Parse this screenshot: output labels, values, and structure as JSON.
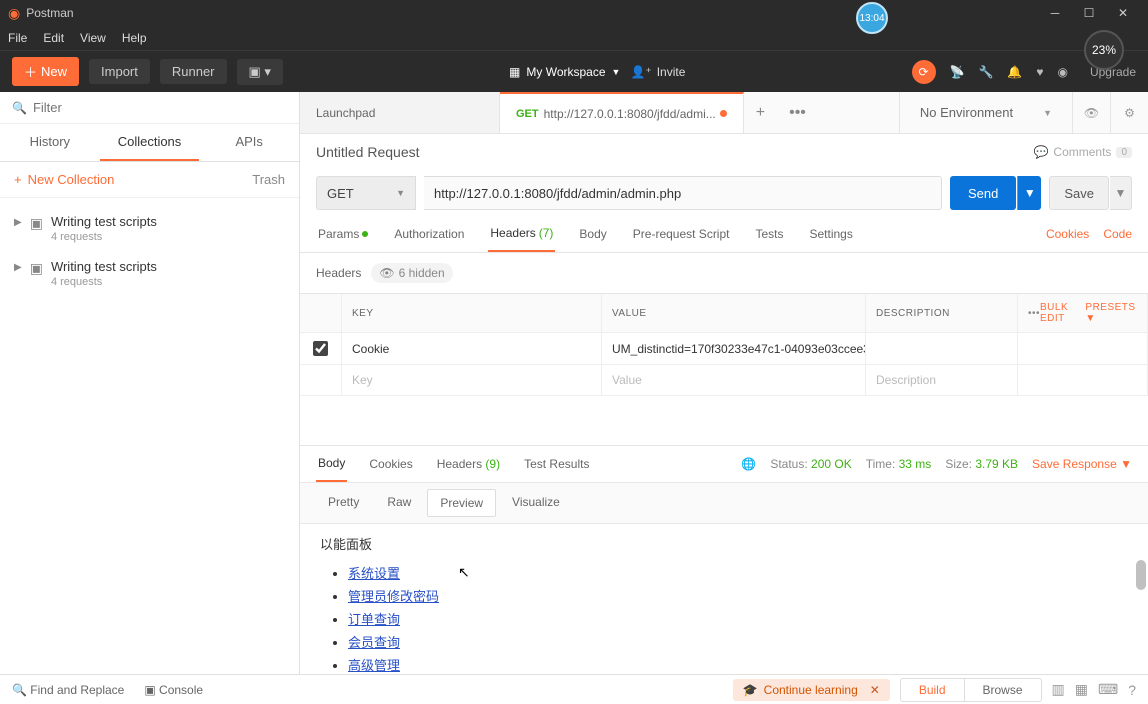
{
  "app": {
    "title": "Postman"
  },
  "overlay": {
    "clock": "13:04",
    "battery": "23%"
  },
  "menu": {
    "file": "File",
    "edit": "Edit",
    "view": "View",
    "help": "Help"
  },
  "toolbar": {
    "new": "New",
    "import": "Import",
    "runner": "Runner",
    "workspace": "My Workspace",
    "invite": "Invite",
    "upgrade": "Upgrade"
  },
  "sidebar": {
    "filter_placeholder": "Filter",
    "tabs": {
      "history": "History",
      "collections": "Collections",
      "apis": "APIs"
    },
    "new_collection": "New Collection",
    "trash": "Trash",
    "items": [
      {
        "title": "Writing test scripts",
        "sub": "4 requests"
      },
      {
        "title": "Writing test scripts",
        "sub": "4 requests"
      }
    ]
  },
  "tabs": {
    "launchpad": "Launchpad",
    "active_method": "GET",
    "active_url": "http://127.0.0.1:8080/jfdd/admi..."
  },
  "environment": {
    "label": "No Environment"
  },
  "request": {
    "name": "Untitled Request",
    "comments": "Comments",
    "comments_count": "0",
    "method": "GET",
    "url": "http://127.0.0.1:8080/jfdd/admin/admin.php",
    "send": "Send",
    "save": "Save",
    "tabs": {
      "params": "Params",
      "auth": "Authorization",
      "headers": "Headers",
      "headers_count": "(7)",
      "body": "Body",
      "prereq": "Pre-request Script",
      "tests": "Tests",
      "settings": "Settings",
      "cookies": "Cookies",
      "code": "Code"
    },
    "headers_label": "Headers",
    "hidden_badge": "6 hidden",
    "table": {
      "cols": {
        "key": "KEY",
        "value": "VALUE",
        "desc": "DESCRIPTION"
      },
      "row": {
        "key": "Cookie",
        "value": "UM_distinctid=170f30233e47c1-04093e03ccee3..."
      },
      "placeholder": {
        "key": "Key",
        "value": "Value",
        "desc": "Description"
      },
      "bulk": "Bulk Edit",
      "presets": "Presets"
    }
  },
  "response": {
    "tabs": {
      "body": "Body",
      "cookies": "Cookies",
      "headers": "Headers",
      "headers_count": "(9)",
      "tests": "Test Results"
    },
    "status_label": "Status:",
    "status_value": "200 OK",
    "time_label": "Time:",
    "time_value": "33 ms",
    "size_label": "Size:",
    "size_value": "3.79 KB",
    "save": "Save Response",
    "view": {
      "pretty": "Pretty",
      "raw": "Raw",
      "preview": "Preview",
      "visualize": "Visualize"
    },
    "body_heading": "以能面板",
    "body_links": [
      "系统设置",
      "管理员修改密码",
      "订单查询",
      "会员查询",
      "高级管理"
    ]
  },
  "footer": {
    "find": "Find and Replace",
    "console": "Console",
    "continue": "Continue learning",
    "build": "Build",
    "browse": "Browse"
  }
}
